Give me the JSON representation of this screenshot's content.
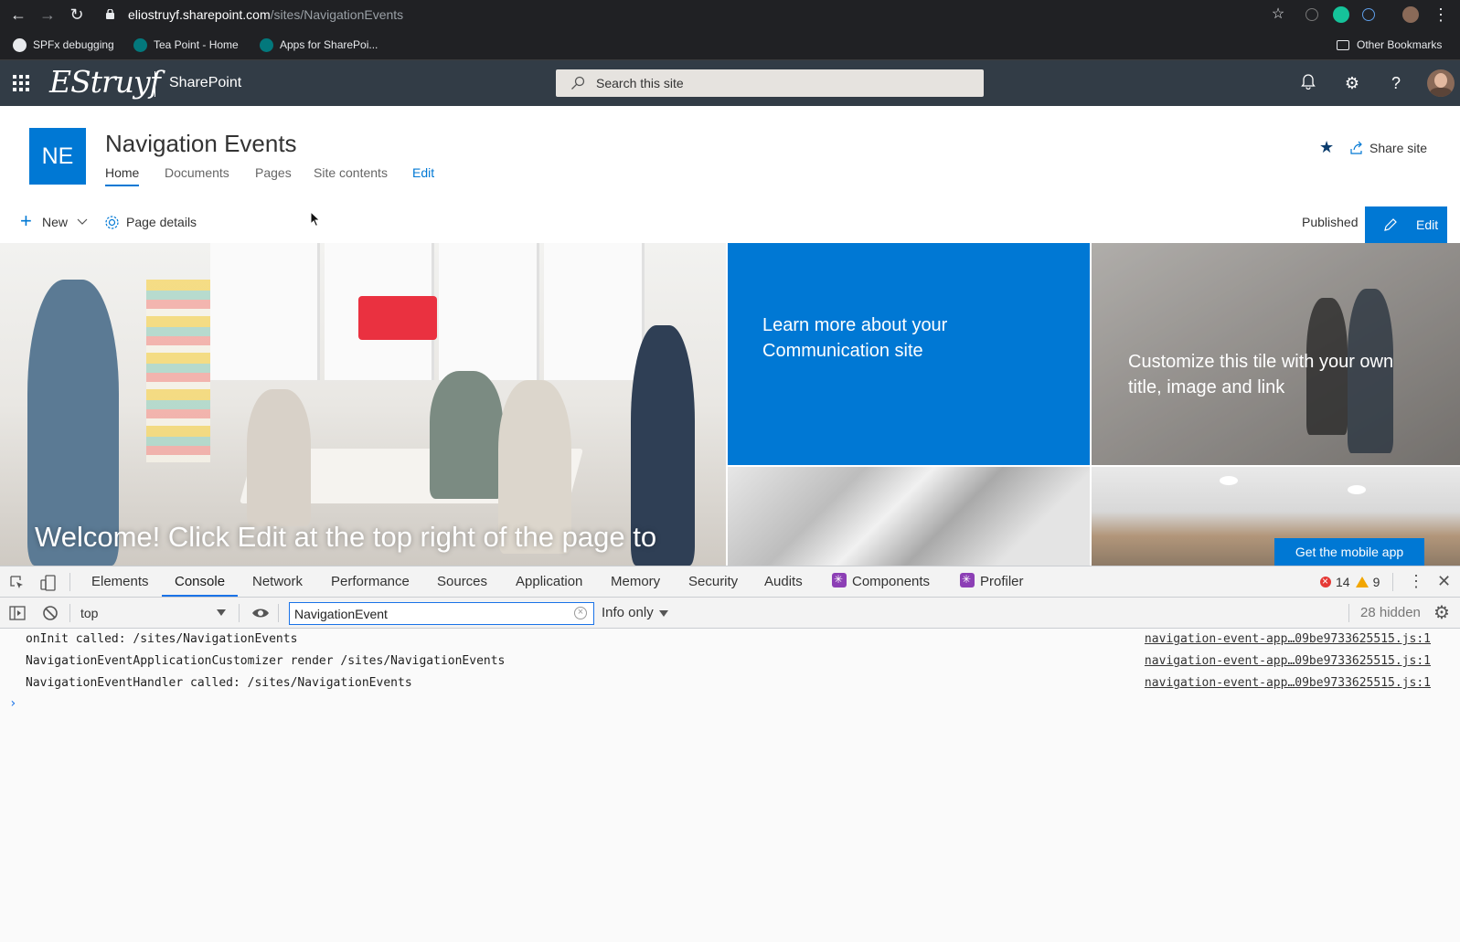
{
  "browser": {
    "url_host": "eliostruyf.sharepoint.com",
    "url_path": "/sites/NavigationEvents",
    "bookmarks": [
      "SPFx debugging",
      "Tea Point - Home",
      "Apps for SharePoi..."
    ],
    "other_bookmarks": "Other Bookmarks"
  },
  "suitebar": {
    "brand": "EStruyf",
    "app_name": "SharePoint",
    "search_placeholder": "Search this site"
  },
  "site": {
    "logo_initials": "NE",
    "title": "Navigation Events",
    "nav": [
      "Home",
      "Documents",
      "Pages",
      "Site contents",
      "Edit"
    ],
    "share_label": "Share site"
  },
  "commandbar": {
    "new_label": "New",
    "page_details_label": "Page details",
    "status": "Published",
    "edit_label": "Edit"
  },
  "hero": {
    "main_caption": "Welcome! Click Edit at the top right of the page to",
    "tile1_text": "Learn more about your Communication site",
    "tile2_text": "Customize this tile with your own title, image and link",
    "mobile_button": "Get the mobile app"
  },
  "devtools": {
    "tabs": [
      "Elements",
      "Console",
      "Network",
      "Performance",
      "Sources",
      "Application",
      "Memory",
      "Security",
      "Audits",
      "Components",
      "Profiler"
    ],
    "active_tab": "Console",
    "error_count": "14",
    "warning_count": "9",
    "context": "top",
    "filter_value": "NavigationEvent",
    "levels": "Info only",
    "hidden": "28 hidden",
    "logs": [
      {
        "message": "onInit called: /sites/NavigationEvents",
        "source": "navigation-event-app…09be9733625515.js:1"
      },
      {
        "message": "NavigationEventApplicationCustomizer render /sites/NavigationEvents",
        "source": "navigation-event-app…09be9733625515.js:1"
      },
      {
        "message": "NavigationEventHandler called: /sites/NavigationEvents",
        "source": "navigation-event-app…09be9733625515.js:1"
      }
    ],
    "prompt": "›"
  },
  "colors": {
    "sp_blue": "#0078d4",
    "suitebar_bg": "#323c46",
    "chrome_bg": "#202124",
    "devtools_accent": "#1a73e8"
  }
}
